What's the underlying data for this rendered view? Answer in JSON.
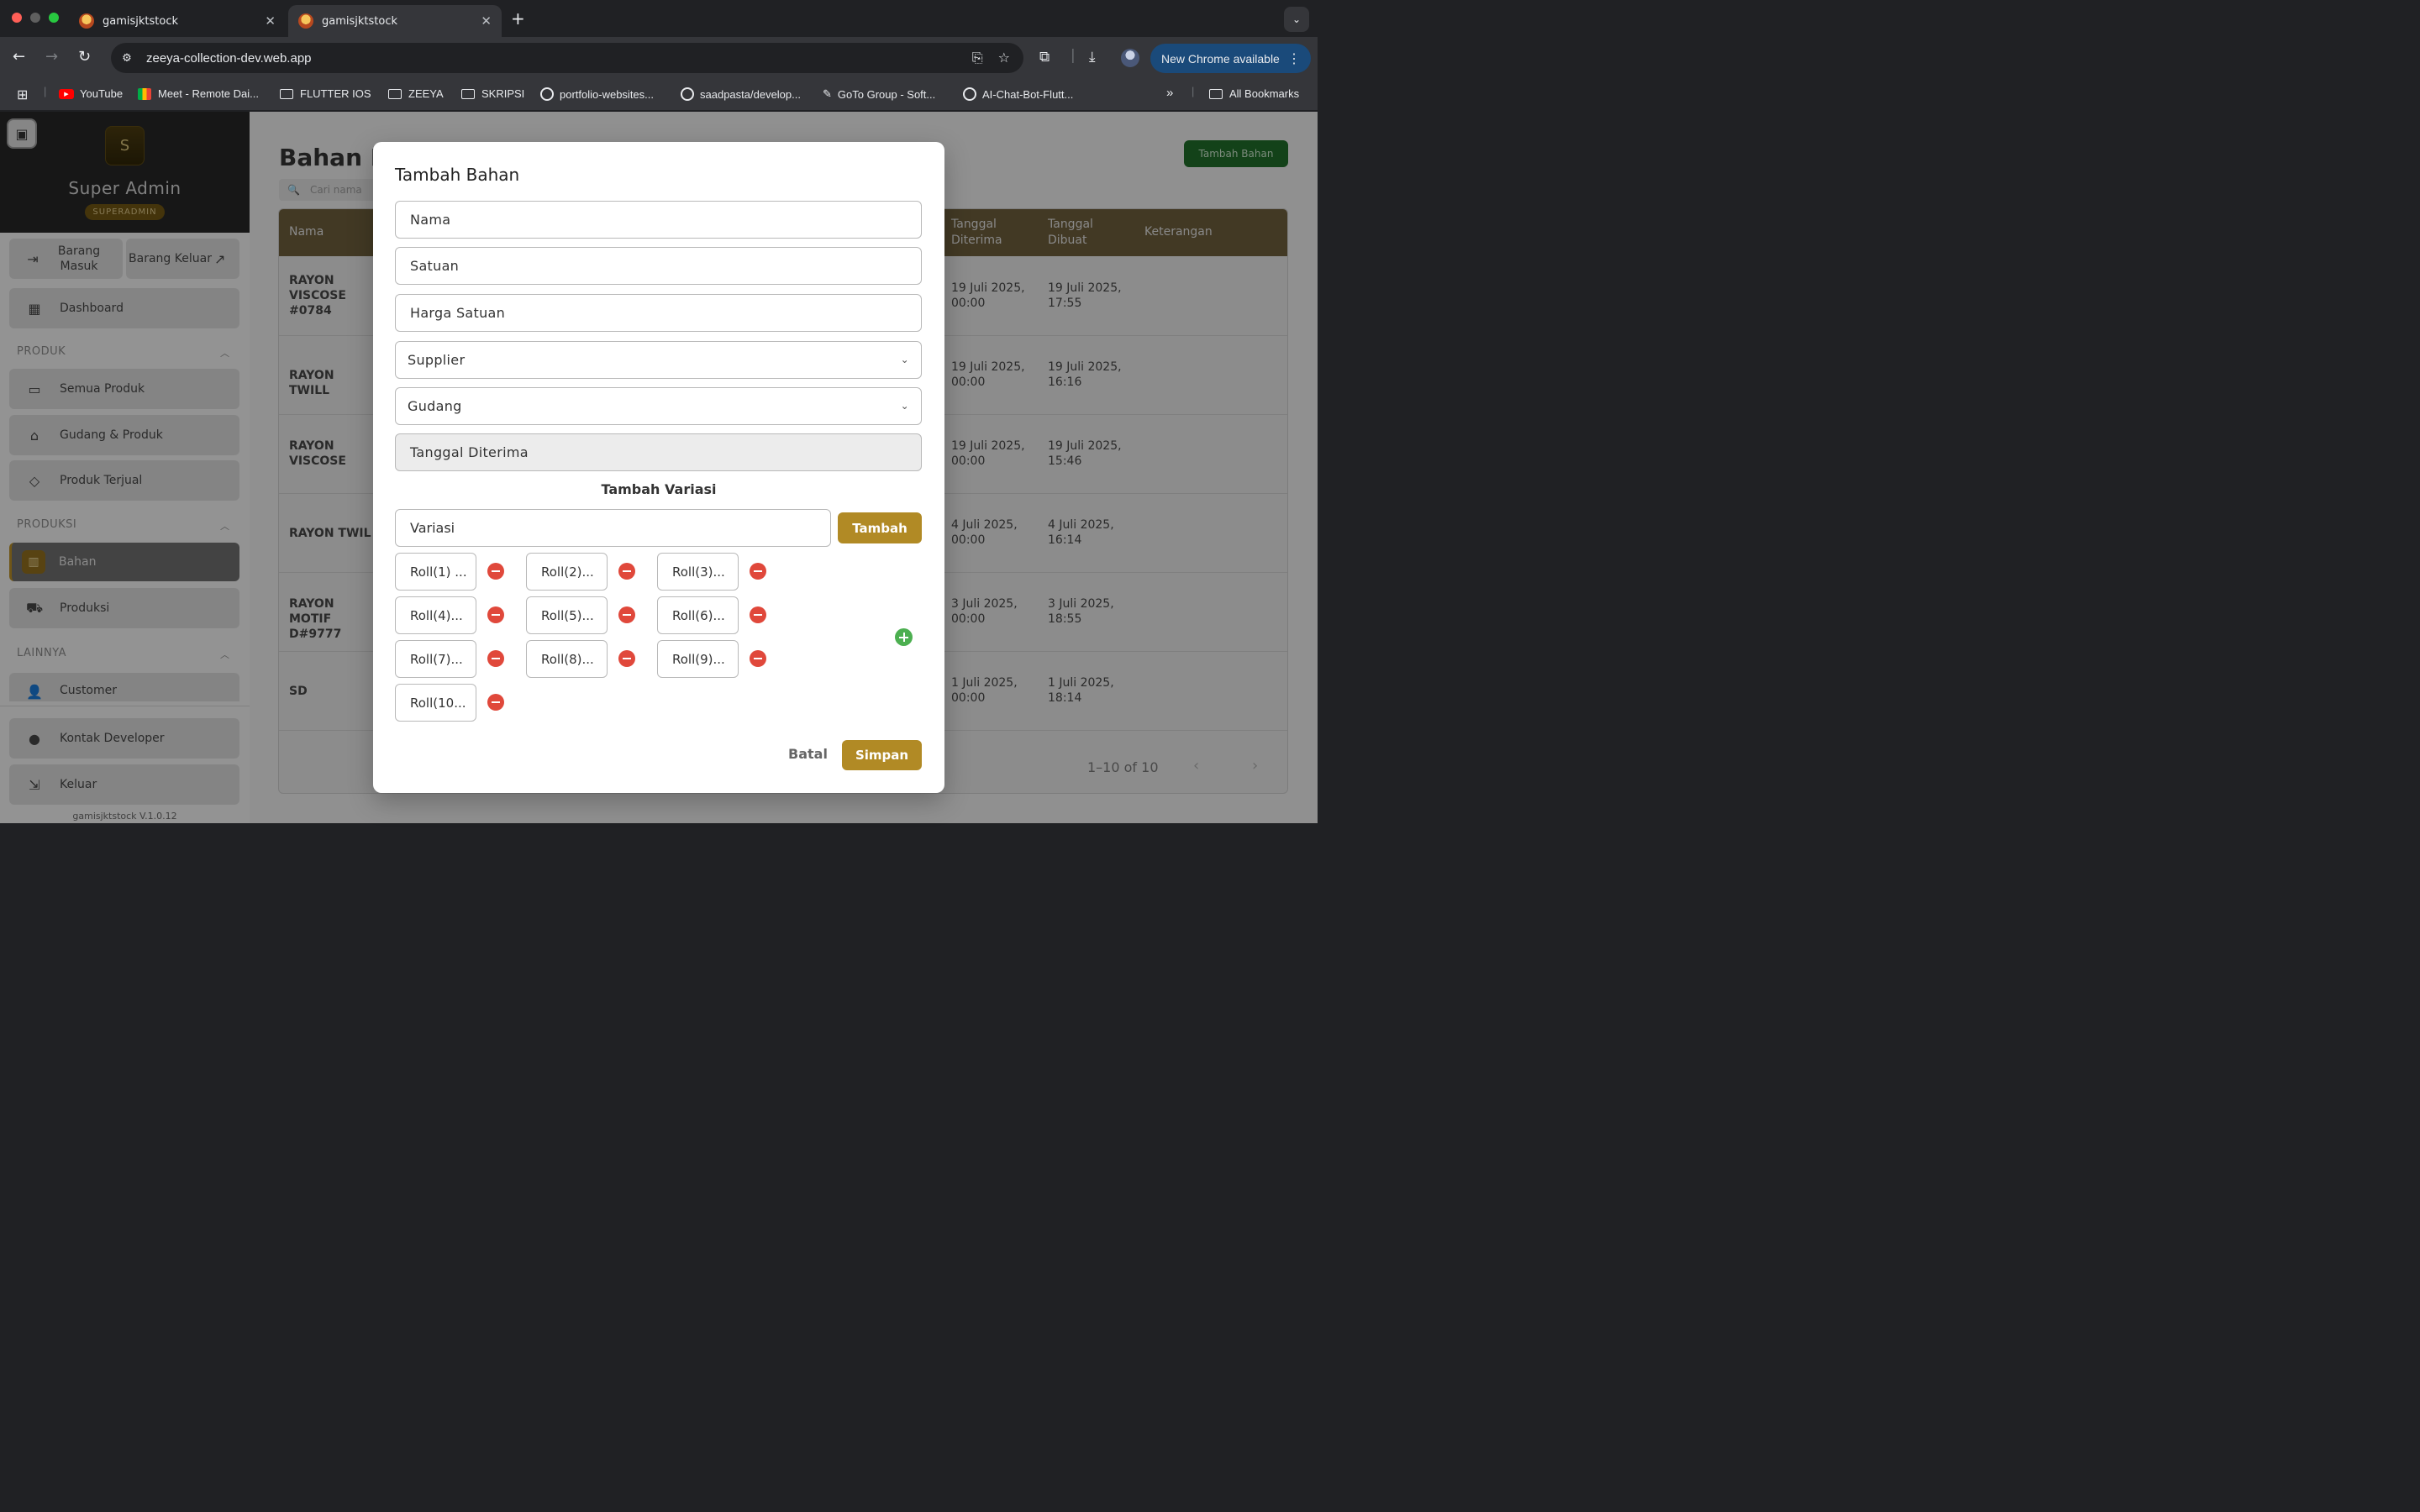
{
  "browser": {
    "tabs": [
      {
        "title": "gamisjktstock",
        "active": false
      },
      {
        "title": "gamisjktstock",
        "active": true
      }
    ],
    "url": "zeeya-collection-dev.web.app",
    "update_label": "New Chrome available",
    "bookmarks": [
      "YouTube",
      "Meet - Remote Dai...",
      "FLUTTER IOS",
      "ZEEYA",
      "SKRIPSI",
      "portfolio-websites...",
      "saadpasta/develop...",
      "GoTo Group - Soft...",
      "AI-Chat-Bot-Flutt..."
    ],
    "all_bookmarks": "All Bookmarks"
  },
  "sidebar": {
    "avatar_initial": "S",
    "user_name": "Super Admin",
    "user_role": "SUPERADMIN",
    "quick_in": "Barang Masuk",
    "quick_out": "Barang Keluar",
    "dashboard": "Dashboard",
    "section_produk": "PRODUK",
    "semua_produk": "Semua Produk",
    "gudang_produk": "Gudang & Produk",
    "produk_terjual": "Produk Terjual",
    "section_produksi": "PRODUKSI",
    "bahan": "Bahan",
    "produksi": "Produksi",
    "section_lainnya": "LAINNYA",
    "customer": "Customer",
    "kontak_developer": "Kontak Developer",
    "keluar": "Keluar",
    "version": "gamisjktstock V.1.0.12"
  },
  "main": {
    "title": "Bahan P",
    "search_placeholder": "Cari nama",
    "add_button": "Tambah Bahan",
    "columns": {
      "nama": "Nama",
      "tanggal_diterima": "Tanggal Diterima",
      "tanggal_dibuat": "Tanggal Dibuat",
      "keterangan": "Keterangan"
    },
    "rows": [
      {
        "nama": "RAYON VISCOSE #0784",
        "diterima": "19 Juli 2025, 00:00",
        "dibuat": "19 Juli 2025, 17:55"
      },
      {
        "nama": "RAYON TWILL",
        "diterima": "19 Juli 2025, 00:00",
        "dibuat": "19 Juli 2025, 16:16"
      },
      {
        "nama": "RAYON VISCOSE",
        "diterima": "19 Juli 2025, 00:00",
        "dibuat": "19 Juli 2025, 15:46"
      },
      {
        "nama": "RAYON TWIL",
        "diterima": "4 Juli 2025, 00:00",
        "dibuat": "4 Juli 2025, 16:14"
      },
      {
        "nama": "RAYON MOTIF D#9777",
        "diterima": "3 Juli 2025, 00:00",
        "dibuat": "3 Juli 2025, 18:55"
      },
      {
        "nama": "SD",
        "diterima": "1 Juli 2025, 00:00",
        "dibuat": "1 Juli 2025, 18:14"
      }
    ],
    "pagination": "1–10 of 10"
  },
  "modal": {
    "title": "Tambah Bahan",
    "nama": "Nama",
    "satuan": "Satuan",
    "harga_satuan": "Harga Satuan",
    "supplier": "Supplier",
    "gudang": "Gudang",
    "tanggal_diterima": "Tanggal Diterima",
    "variasi_heading": "Tambah Variasi",
    "variasi_placeholder": "Variasi",
    "tambah": "Tambah",
    "rolls": [
      "Roll(1) ...",
      "Roll(2)...",
      "Roll(3)...",
      "Roll(4)...",
      "Roll(5)...",
      "Roll(6)...",
      "Roll(7)...",
      "Roll(8)...",
      "Roll(9)...",
      "Roll(10..."
    ],
    "batal": "Batal",
    "simpan": "Simpan"
  },
  "colors": {
    "accent": "#b18a25",
    "danger": "#e0483b",
    "success": "#4caf50"
  }
}
